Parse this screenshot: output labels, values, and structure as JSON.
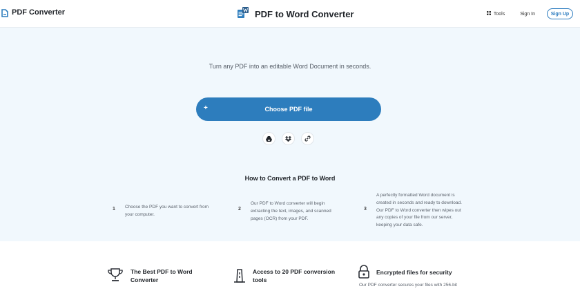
{
  "header": {
    "brand_name": "PDF Converter",
    "page_title": "PDF to Word Converter",
    "nav_tools": "Tools",
    "nav_signin": "Sign In",
    "nav_signup": "Sign Up"
  },
  "hero": {
    "subtitle": "Turn any PDF into an editable Word Document in seconds.",
    "choose_button": "Choose PDF file",
    "choose_icon_glyph": "+",
    "sources": [
      "google-drive-icon",
      "dropbox-icon",
      "link-icon"
    ]
  },
  "how_to": {
    "title": "How to Convert a PDF to Word",
    "steps": [
      {
        "number": "1",
        "lines": [
          "Choose the PDF you want to convert from",
          "your computer."
        ]
      },
      {
        "number": "2",
        "lines": [
          "Our PDF to Word converter will begin",
          "extracting the text, images, and scanned",
          "pages (OCR) from your PDF."
        ]
      },
      {
        "number": "3",
        "lines": [
          "A perfectly formatted Word document is",
          "created in seconds and ready to download.",
          "Our PDF to Word converter then wipes out",
          "any copies of your file from our server,",
          "keeping your data safe."
        ]
      }
    ]
  },
  "features": [
    {
      "icon": "trophy-icon",
      "title_lines": [
        "The Best PDF to Word",
        "Converter"
      ]
    },
    {
      "icon": "tools-icon",
      "title_lines": [
        "Access to 20 PDF conversion",
        "tools"
      ]
    },
    {
      "icon": "lock-icon",
      "title_lines": [
        "Encrypted files for security"
      ],
      "description": "Our PDF converter secures your files with 256-bit"
    }
  ],
  "colors": {
    "accent": "#2d7dbd",
    "hero_background": "#f1f8fd",
    "signup_border": "#2b7bbf"
  }
}
